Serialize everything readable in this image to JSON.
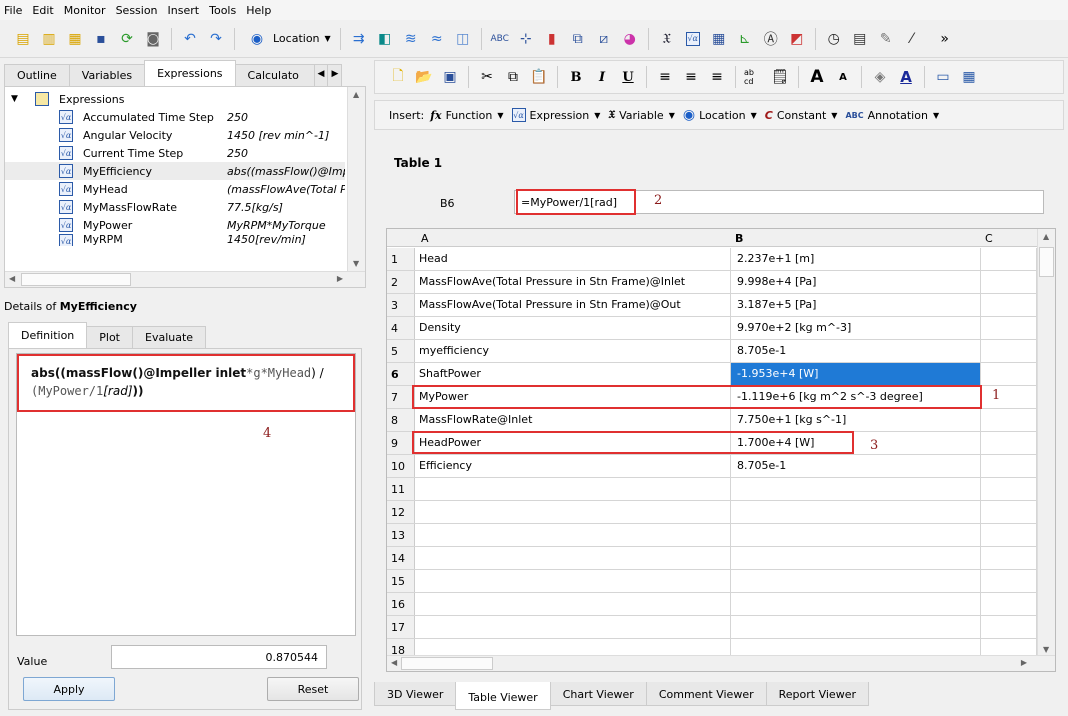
{
  "menu": [
    "File",
    "Edit",
    "Monitor",
    "Session",
    "Insert",
    "Tools",
    "Help"
  ],
  "main_toolbar": {
    "location_label": "Location",
    "more": "»",
    "icons": [
      "new-case-icon",
      "load-results-icon",
      "load-state-icon",
      "save-state-icon",
      "refresh-icon",
      "screenshot-icon",
      "undo-icon",
      "redo-icon"
    ],
    "insert_icons": [
      "vector-icon",
      "contour-icon",
      "streamline-icon",
      "particle-track-icon",
      "volume-icon",
      "text-icon",
      "coordinate-frame-icon",
      "legend-icon",
      "instance-transform-icon",
      "clip-plane-icon",
      "color-map-icon",
      "variable-icon",
      "expression-icon",
      "table-icon",
      "chart-icon",
      "comment-icon",
      "figure-icon",
      "timestep-icon",
      "animation-icon",
      "quick-editor-icon",
      "probe-icon"
    ]
  },
  "left_tabs": [
    "Outline",
    "Variables",
    "Expressions",
    "Calculato"
  ],
  "tree": {
    "root": "Expressions",
    "items": [
      {
        "name": "Accumulated Time Step",
        "value": "250"
      },
      {
        "name": "Angular Velocity",
        "value": "1450 [rev min^-1]"
      },
      {
        "name": "Current Time Step",
        "value": "250"
      },
      {
        "name": "MyEfficiency",
        "value": "abs((massFlow()@Imp"
      },
      {
        "name": "MyHead",
        "value": "(massFlowAve(Total P"
      },
      {
        "name": "MyMassFlowRate",
        "value": "77.5[kg/s]"
      },
      {
        "name": "MyPower",
        "value": "MyRPM*MyTorque"
      },
      {
        "name": "MyRPM",
        "value": "1450[rev/min]"
      }
    ]
  },
  "details": {
    "prefix": "Details of ",
    "name": "MyEfficiency",
    "tabs": [
      "Definition",
      "Plot",
      "Evaluate"
    ],
    "formula": {
      "p1": "abs(",
      "p2": "(massFlow()",
      "p3": "@Impeller inlet",
      "p4": "*g*MyHead",
      "p5": ") /",
      "p6": "(MyPower/1",
      "p7": "[rad]",
      "p8": "))"
    },
    "value_label": "Value",
    "value": "0.870544",
    "apply": "Apply",
    "reset": "Reset"
  },
  "annotations": {
    "a1": "1",
    "a2": "2",
    "a3": "3",
    "a4": "4"
  },
  "format_toolbar": {
    "icons": [
      "new-icon",
      "open-icon",
      "save-icon",
      "cut-icon",
      "copy-icon",
      "paste-icon",
      "bold-icon",
      "italic-icon",
      "underline-icon",
      "align-left-icon",
      "align-center-icon",
      "align-right-icon",
      "number-format-icon",
      "cell-properties-icon",
      "font-larger-icon",
      "font-smaller-icon",
      "fill-color-icon",
      "text-color-icon",
      "borders-icon",
      "grid-icon"
    ]
  },
  "insert_bar": {
    "label": "Insert:",
    "items": [
      "Function",
      "Expression",
      "Variable",
      "Location",
      "Constant",
      "Annotation"
    ]
  },
  "table": {
    "title": "Table 1",
    "cell_ref": "B6",
    "formula": "=MyPower/1[rad]",
    "columns": [
      "A",
      "B",
      "C"
    ],
    "rows": [
      {
        "n": "1",
        "a": "Head",
        "b": "2.237e+1 [m]"
      },
      {
        "n": "2",
        "a": "MassFlowAve(Total Pressure in Stn Frame)@Inlet",
        "b": "9.998e+4 [Pa]"
      },
      {
        "n": "3",
        "a": "MassFlowAve(Total Pressure in Stn Frame)@Out",
        "b": "3.187e+5 [Pa]"
      },
      {
        "n": "4",
        "a": "Density",
        "b": "9.970e+2 [kg m^-3]"
      },
      {
        "n": "5",
        "a": "myefficiency",
        "b": "8.705e-1"
      },
      {
        "n": "6",
        "a": "ShaftPower",
        "b": "-1.953e+4 [W]"
      },
      {
        "n": "7",
        "a": "MyPower",
        "b": "-1.119e+6 [kg m^2 s^-3 degree]"
      },
      {
        "n": "8",
        "a": "MassFlowRate@Inlet",
        "b": "7.750e+1 [kg s^-1]"
      },
      {
        "n": "9",
        "a": "HeadPower",
        "b": "1.700e+4 [W]"
      },
      {
        "n": "10",
        "a": "Efficiency",
        "b": "8.705e-1"
      },
      {
        "n": "11",
        "a": "",
        "b": ""
      },
      {
        "n": "12",
        "a": "",
        "b": ""
      },
      {
        "n": "13",
        "a": "",
        "b": ""
      },
      {
        "n": "14",
        "a": "",
        "b": ""
      },
      {
        "n": "15",
        "a": "",
        "b": ""
      },
      {
        "n": "16",
        "a": "",
        "b": ""
      },
      {
        "n": "17",
        "a": "",
        "b": ""
      },
      {
        "n": "18",
        "a": "",
        "b": ""
      }
    ],
    "selected_row": "6"
  },
  "viewer_tabs": [
    "3D Viewer",
    "Table Viewer",
    "Chart Viewer",
    "Comment Viewer",
    "Report Viewer"
  ],
  "colors": {
    "selection": "#1f7ad6",
    "highlight_box": "#e03030",
    "annotation": "#8b1a1a"
  }
}
